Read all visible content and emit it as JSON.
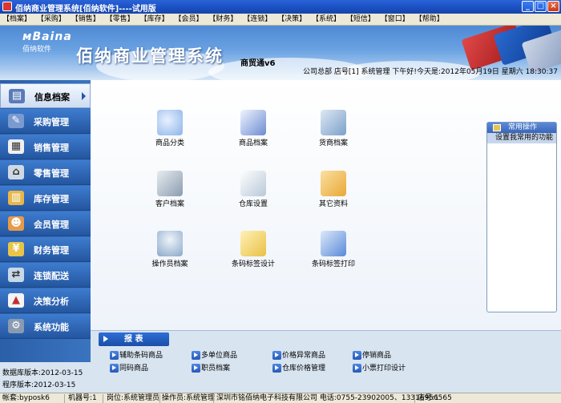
{
  "window": {
    "title": "佰纳商业管理系统[佰纳软件]----试用版",
    "controls": {
      "minimize": "_",
      "maximize": "□",
      "close": "×"
    }
  },
  "menu": [
    "【档案】",
    "【采购】",
    "【销售】",
    "【零售】",
    "【库存】",
    "【会员】",
    "【财务】",
    "【连锁】",
    "【决策】",
    "【系统】",
    "【短信】",
    "【窗口】",
    "【帮助】"
  ],
  "banner": {
    "logo_mark": "ᴍBaina",
    "logo_cn": "佰纳软件",
    "title": "佰纳商业管理系统",
    "version": "商贸通v6",
    "info": "公司总部  店号[1]  系统管理  下午好!今天是:2012年05月19日  星期六  18:30:37"
  },
  "sidebar": {
    "items": [
      {
        "label": "信息档案",
        "icon": "info-file-icon",
        "active": true
      },
      {
        "label": "采购管理",
        "icon": "purchase-icon"
      },
      {
        "label": "销售管理",
        "icon": "sales-icon"
      },
      {
        "label": "零售管理",
        "icon": "retail-basket-icon"
      },
      {
        "label": "库存管理",
        "icon": "inventory-icon"
      },
      {
        "label": "会员管理",
        "icon": "members-icon"
      },
      {
        "label": "财务管理",
        "icon": "finance-icon"
      },
      {
        "label": "连锁配送",
        "icon": "chain-delivery-icon"
      },
      {
        "label": "决策分析",
        "icon": "analysis-icon"
      },
      {
        "label": "系统功能",
        "icon": "system-gear-icon"
      }
    ],
    "db_version": "数据库版本:2012-03-15",
    "app_version": "程序版本:2012-03-15"
  },
  "functions": [
    {
      "label": "商品分类",
      "icon": "category-icon",
      "color": "#8bb4e8"
    },
    {
      "label": "商品档案",
      "icon": "goods-file-icon",
      "color": "#6d8cd0"
    },
    {
      "label": "货商档案",
      "icon": "supplier-file-icon",
      "color": "#7aa0c8"
    },
    {
      "label": "客户档案",
      "icon": "customer-file-icon",
      "color": "#8a9cb0"
    },
    {
      "label": "仓库设置",
      "icon": "warehouse-icon",
      "color": "#b8c8d8"
    },
    {
      "label": "其它资料",
      "icon": "other-data-icon",
      "color": "#e8a838"
    },
    {
      "label": "操作员档案",
      "icon": "operator-file-icon",
      "color": "#8aa8c8"
    },
    {
      "label": "条码标签设计",
      "icon": "barcode-design-icon",
      "color": "#e8c044"
    },
    {
      "label": "条码标签打印",
      "icon": "barcode-print-icon",
      "color": "#5a8ad8"
    }
  ],
  "common_ops": {
    "title": "常用操作",
    "item": "设置我常用的功能"
  },
  "reports": {
    "title": "报  表",
    "links": [
      "辅助条码商品",
      "多单位商品",
      "价格异常商品",
      "停销商品",
      "同码商品",
      "职员档案",
      "仓库价格管理",
      "小票打印设计"
    ]
  },
  "status": {
    "account": "帐套:byposk6",
    "machine": "机器号:1",
    "post": "岗位:系统管理员",
    "operator": "操作员:系统管理",
    "company": "深圳市铭佰纳电子科技有限公司  电话:0755-23902005、13316956565",
    "store": "店号:1"
  },
  "colors": {
    "titlebar": "#1a4fc0",
    "sidebar": "#2456a0",
    "accent": "#2e6ed6"
  }
}
